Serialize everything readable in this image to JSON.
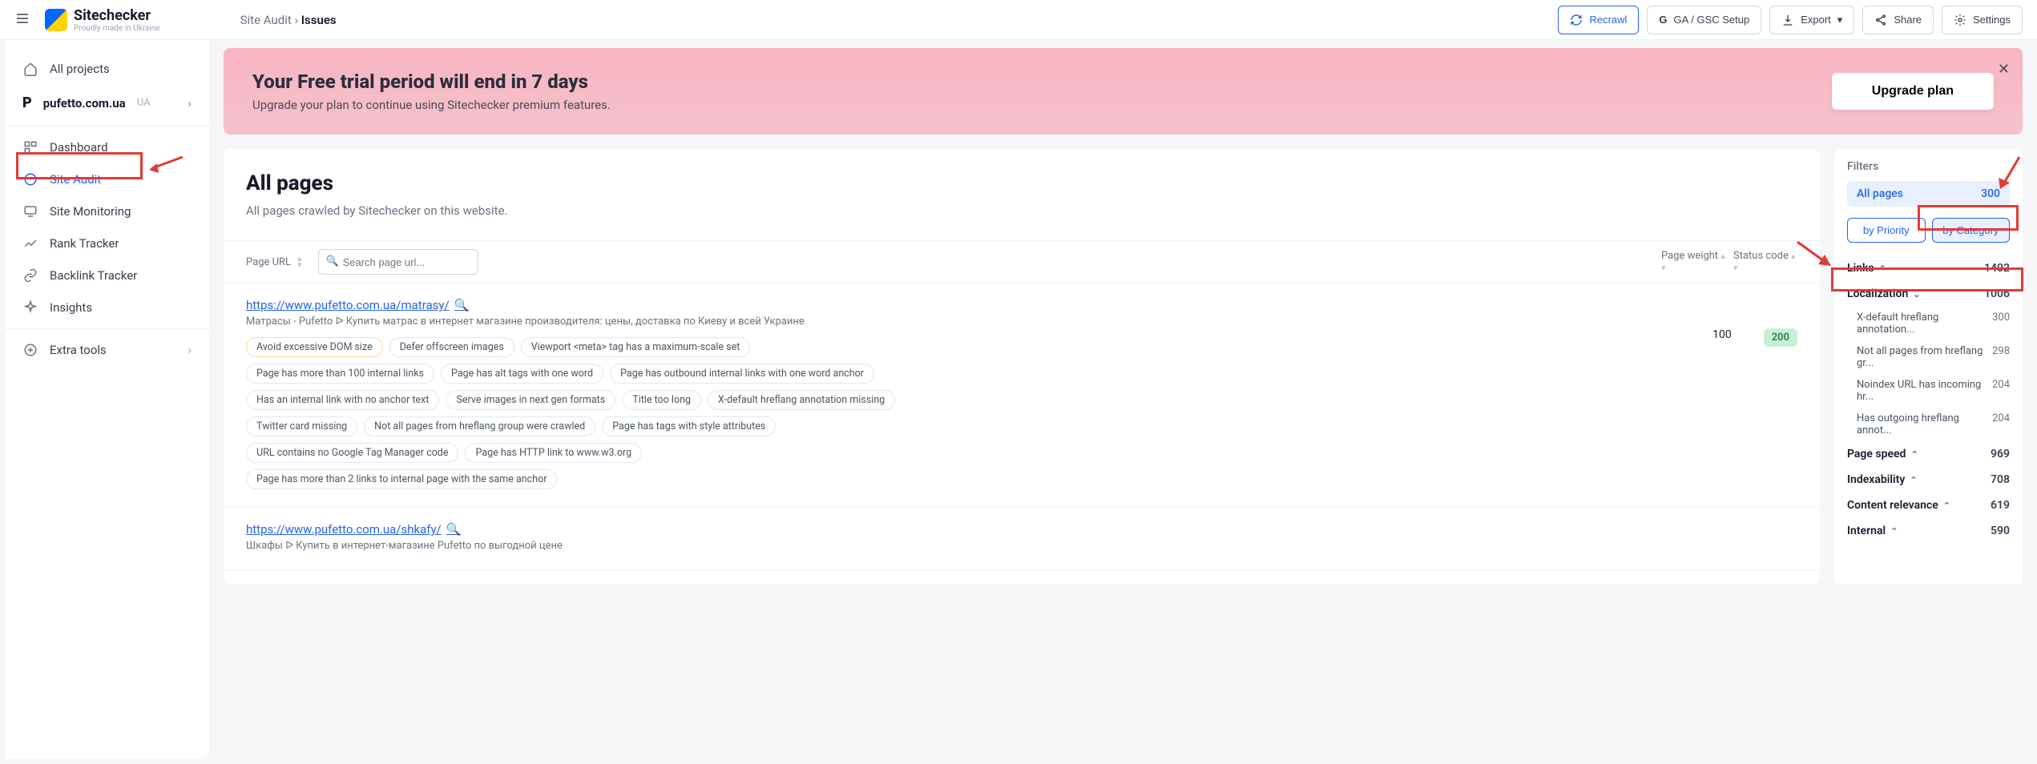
{
  "logo": {
    "name": "Sitechecker",
    "tagline": "Proudly made in Ukraine"
  },
  "breadcrumb": {
    "parent": "Site Audit",
    "sep": "›",
    "current": "Issues"
  },
  "header_actions": {
    "recrawl": "Recrawl",
    "ga_gsc": "GA / GSC Setup",
    "export": "Export",
    "share": "Share",
    "settings": "Settings"
  },
  "sidebar": {
    "all_projects": "All projects",
    "project": {
      "domain": "pufetto.com.ua",
      "cc": "UA"
    },
    "items": {
      "dashboard": "Dashboard",
      "site_audit": "Site Audit",
      "site_monitoring": "Site Monitoring",
      "rank_tracker": "Rank Tracker",
      "backlink_tracker": "Backlink Tracker",
      "insights": "Insights",
      "extra_tools": "Extra tools"
    }
  },
  "banner": {
    "title": "Your Free trial period will end in 7 days",
    "subtitle": "Upgrade your plan to continue using Sitechecker premium features.",
    "cta": "Upgrade plan"
  },
  "all_pages": {
    "title": "All pages",
    "subtitle": "All pages crawled by Sitechecker on this website.",
    "columns": {
      "url": "Page URL",
      "weight": "Page weight",
      "status": "Status code"
    },
    "search_placeholder": "Search page url...",
    "rows": [
      {
        "url": "https://www.pufetto.com.ua/matrasy/",
        "desc": "Матрасы - Pufetto ᐅ Купить матрас в интернет магазине производителя: цены, доставка по Киеву и всей Украине",
        "weight": "100",
        "status": "200",
        "tags": [
          "Avoid excessive DOM size",
          "Defer offscreen images",
          "Viewport <meta> tag has a maximum-scale set",
          "Page has more than 100 internal links",
          "Page has alt tags with one word",
          "Page has outbound internal links with one word anchor",
          "Has an internal link with no anchor text",
          "Serve images in next gen formats",
          "Title too long",
          "X-default hreflang annotation missing",
          "Twitter card missing",
          "Not all pages from hreflang group were crawled",
          "Page has tags with style attributes",
          "URL contains no Google Tag Manager code",
          "Page has HTTP link to www.w3.org",
          "Page has more than 2 links to internal page with the same anchor"
        ]
      },
      {
        "url": "https://www.pufetto.com.ua/shkafy/",
        "desc": "Шкафы ᐅ Купить в интернет-магазине Pufetto по выгодной цене",
        "weight": "",
        "status": "",
        "tags": []
      }
    ]
  },
  "filters": {
    "title": "Filters",
    "all_pages_label": "All pages",
    "all_pages_count": "300",
    "tabs": {
      "priority": "by Priority",
      "category": "by Category"
    },
    "categories": [
      {
        "name": "Links",
        "count": "1402",
        "open": false,
        "key": "links"
      },
      {
        "name": "Localization",
        "count": "1006",
        "open": true,
        "key": "localization",
        "subs": [
          {
            "name": "X-default hreflang annotation...",
            "count": "300"
          },
          {
            "name": "Not all pages from hreflang gr...",
            "count": "298"
          },
          {
            "name": "Noindex URL has incoming hr...",
            "count": "204"
          },
          {
            "name": "Has outgoing hreflang annot...",
            "count": "204"
          }
        ]
      },
      {
        "name": "Page speed",
        "count": "969",
        "open": false,
        "key": "pagespeed"
      },
      {
        "name": "Indexability",
        "count": "708",
        "open": false,
        "key": "indexability"
      },
      {
        "name": "Content relevance",
        "count": "619",
        "open": false,
        "key": "contentrel"
      },
      {
        "name": "Internal",
        "count": "590",
        "open": false,
        "key": "internal"
      }
    ]
  }
}
